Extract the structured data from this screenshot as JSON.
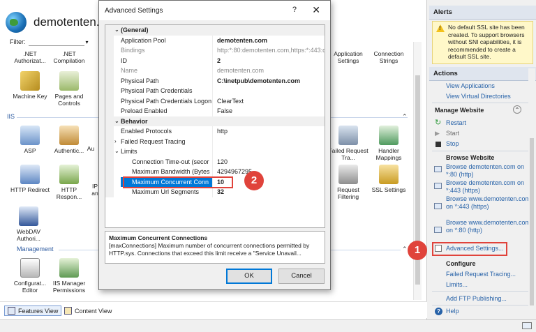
{
  "site": {
    "title": "demotenten.co"
  },
  "filter": {
    "label": "Filter:"
  },
  "features": {
    "row1": [
      ".NET Authorizat...",
      ".NET Compilation",
      "Application Settings",
      "Connection Strings"
    ],
    "row2": [
      "Machine Key",
      "Pages and Controls"
    ],
    "iis_section": "IIS",
    "iis_row1": [
      "ASP",
      "Authentic...",
      "Au",
      "Failed Request Tra...",
      "Handler Mappings"
    ],
    "iis_row2": [
      "HTTP Redirect",
      "HTTP Respon...",
      "IP an",
      "Request Filtering",
      "SSL Settings"
    ],
    "iis_row3": [
      "WebDAV Authori..."
    ],
    "management_section": "Management",
    "mgmt_row": [
      "Configurat... Editor",
      "IIS Manager Permissions"
    ]
  },
  "view_tabs": {
    "features": "Features View",
    "content": "Content View"
  },
  "right_pane": {
    "alerts_header": "Alerts",
    "alert_text": "No default SSL site has been created. To support browsers without SNI capabilities, it is recommended to create a default SSL site.",
    "actions_header": "Actions",
    "view_applications": "View Applications",
    "view_virtual_directories": "View Virtual Directories",
    "manage_website": "Manage Website",
    "restart": "Restart",
    "start": "Start",
    "stop": "Stop",
    "browse_website": "Browse Website",
    "browse1": "Browse demotenten.com on *:80 (http)",
    "browse2": "Browse demotenten.com on *:443 (https)",
    "browse3": "Browse www.demotenten.com on *:443 (https)",
    "browse4": "Browse www.demotenten.com on *:80 (http)",
    "advanced_settings": "Advanced Settings...",
    "configure": "Configure",
    "failed_request_tracing": "Failed Request Tracing...",
    "limits": "Limits...",
    "add_ftp": "Add FTP Publishing...",
    "help": "Help"
  },
  "dialog": {
    "title": "Advanced Settings",
    "help_glyph": "?",
    "close_glyph": "✕",
    "rows": [
      {
        "type": "cat",
        "name": "(General)",
        "toggle": "⌄"
      },
      {
        "type": "prop",
        "name": "Application Pool",
        "value": "demotenten.com",
        "bold": true
      },
      {
        "type": "prop",
        "name": "Bindings",
        "value": "http:*:80:demotenten.com,https:*:443:d",
        "grey": true
      },
      {
        "type": "prop",
        "name": "ID",
        "value": "2",
        "bold": true
      },
      {
        "type": "prop",
        "name": "Name",
        "value": "demotenten.com",
        "grey": true
      },
      {
        "type": "prop",
        "name": "Physical Path",
        "value": "C:\\inetpub\\demotenten.com",
        "bold": true
      },
      {
        "type": "prop",
        "name": "Physical Path Credentials",
        "value": ""
      },
      {
        "type": "prop",
        "name": "Physical Path Credentials Logon",
        "value": "ClearText"
      },
      {
        "type": "prop",
        "name": "Preload Enabled",
        "value": "False"
      },
      {
        "type": "cat",
        "name": "Behavior",
        "toggle": "⌄"
      },
      {
        "type": "prop",
        "name": "Enabled Protocols",
        "value": "http"
      },
      {
        "type": "prop",
        "name": "Failed Request Tracing",
        "value": "",
        "toggle": "›"
      },
      {
        "type": "prop",
        "name": "Limits",
        "value": "",
        "toggle": "⌄"
      },
      {
        "type": "sub",
        "name": "Connection Time-out (secor",
        "value": "120"
      },
      {
        "type": "sub",
        "name": "Maximum Bandwidth (Bytes",
        "value": "4294967295"
      },
      {
        "type": "sub",
        "name": "Maximum Concurrent Conn",
        "value": "10",
        "selected": true
      },
      {
        "type": "sub",
        "name": "Maximum Url Segments",
        "value": "32",
        "bold": true
      }
    ],
    "desc_title": "Maximum Concurrent Connections",
    "desc_text": "[maxConnections] Maximum number of concurrent connections permitted by HTTP.sys. Connections that exceed this limit receive a \"Service Unavail...",
    "ok": "OK",
    "cancel": "Cancel"
  },
  "badges": {
    "one": "1",
    "two": "2"
  },
  "colors": {
    "accent_red": "#e0433b",
    "link_blue": "#2762a8",
    "selection": "#0078d7"
  }
}
